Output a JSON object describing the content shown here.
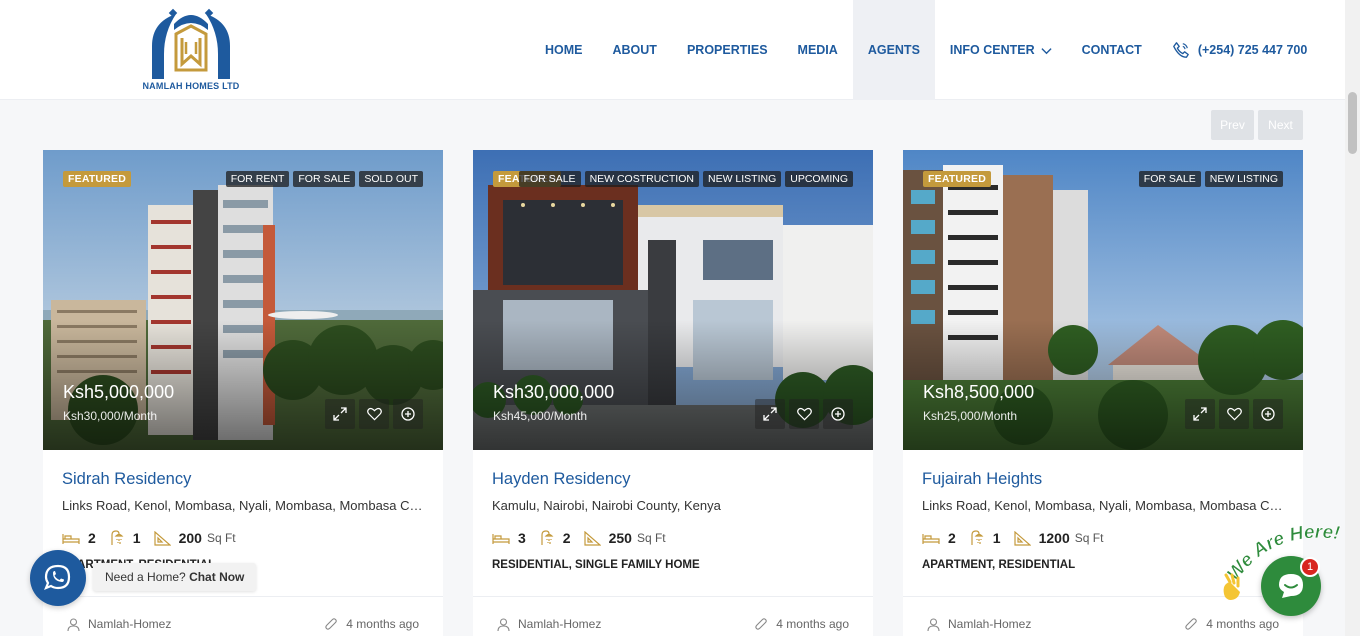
{
  "brand": {
    "name": "NAMLAH HOMES LTD"
  },
  "nav": {
    "items": [
      {
        "label": "HOME"
      },
      {
        "label": "ABOUT"
      },
      {
        "label": "PROPERTIES"
      },
      {
        "label": "MEDIA"
      },
      {
        "label": "AGENTS",
        "active": true
      },
      {
        "label": "INFO CENTER",
        "has_dropdown": true
      },
      {
        "label": "CONTACT"
      }
    ],
    "phone": "(+254) 725 447 700"
  },
  "pager": {
    "prev_label": "Prev",
    "next_label": "Next"
  },
  "cards": [
    {
      "featured": "FEATURED",
      "tags": [
        "FOR RENT",
        "FOR SALE",
        "SOLD OUT"
      ],
      "price": "Ksh5,000,000",
      "rent": "Ksh30,000/Month",
      "title": "Sidrah Residency",
      "address": "Links Road, Kenol, Mombasa, Nyali, Mombasa, Mombasa County, Kenya",
      "beds": "2",
      "baths": "1",
      "area": "200",
      "area_unit": "Sq Ft",
      "type": "APARTMENT, RESIDENTIAL",
      "agent": "Namlah-Homez",
      "date": "4 months ago"
    },
    {
      "featured": "FEATURED",
      "tags": [
        "FOR SALE",
        "NEW COSTRUCTION",
        "NEW LISTING",
        "UPCOMING"
      ],
      "price": "Ksh30,000,000",
      "rent": "Ksh45,000/Month",
      "title": "Hayden Residency",
      "address": "Kamulu, Nairobi, Nairobi County, Kenya",
      "beds": "3",
      "baths": "2",
      "area": "250",
      "area_unit": "Sq Ft",
      "type": "RESIDENTIAL, SINGLE FAMILY HOME",
      "agent": "Namlah-Homez",
      "date": "4 months ago"
    },
    {
      "featured": "FEATURED",
      "tags": [
        "FOR SALE",
        "NEW LISTING"
      ],
      "price": "Ksh8,500,000",
      "rent": "Ksh25,000/Month",
      "title": "Fujairah Heights",
      "address": "Links Road, Kenol, Mombasa, Nyali, Mombasa, Mombasa County, Kenya",
      "beds": "2",
      "baths": "1",
      "area": "1200",
      "area_unit": "Sq Ft",
      "type": "APARTMENT, RESIDENTIAL",
      "agent": "Namlah-Homez",
      "date": "4 months ago"
    }
  ],
  "whatsapp": {
    "prefix": "Need a Home?",
    "cta": "Chat Now"
  },
  "chat": {
    "badge": "1",
    "banner": "We Are Here!"
  },
  "colors": {
    "brand_blue": "#1e5a9e",
    "gold": "#c49a3c",
    "chat_green": "#2e8b3c",
    "badge_red": "#d8261f"
  }
}
